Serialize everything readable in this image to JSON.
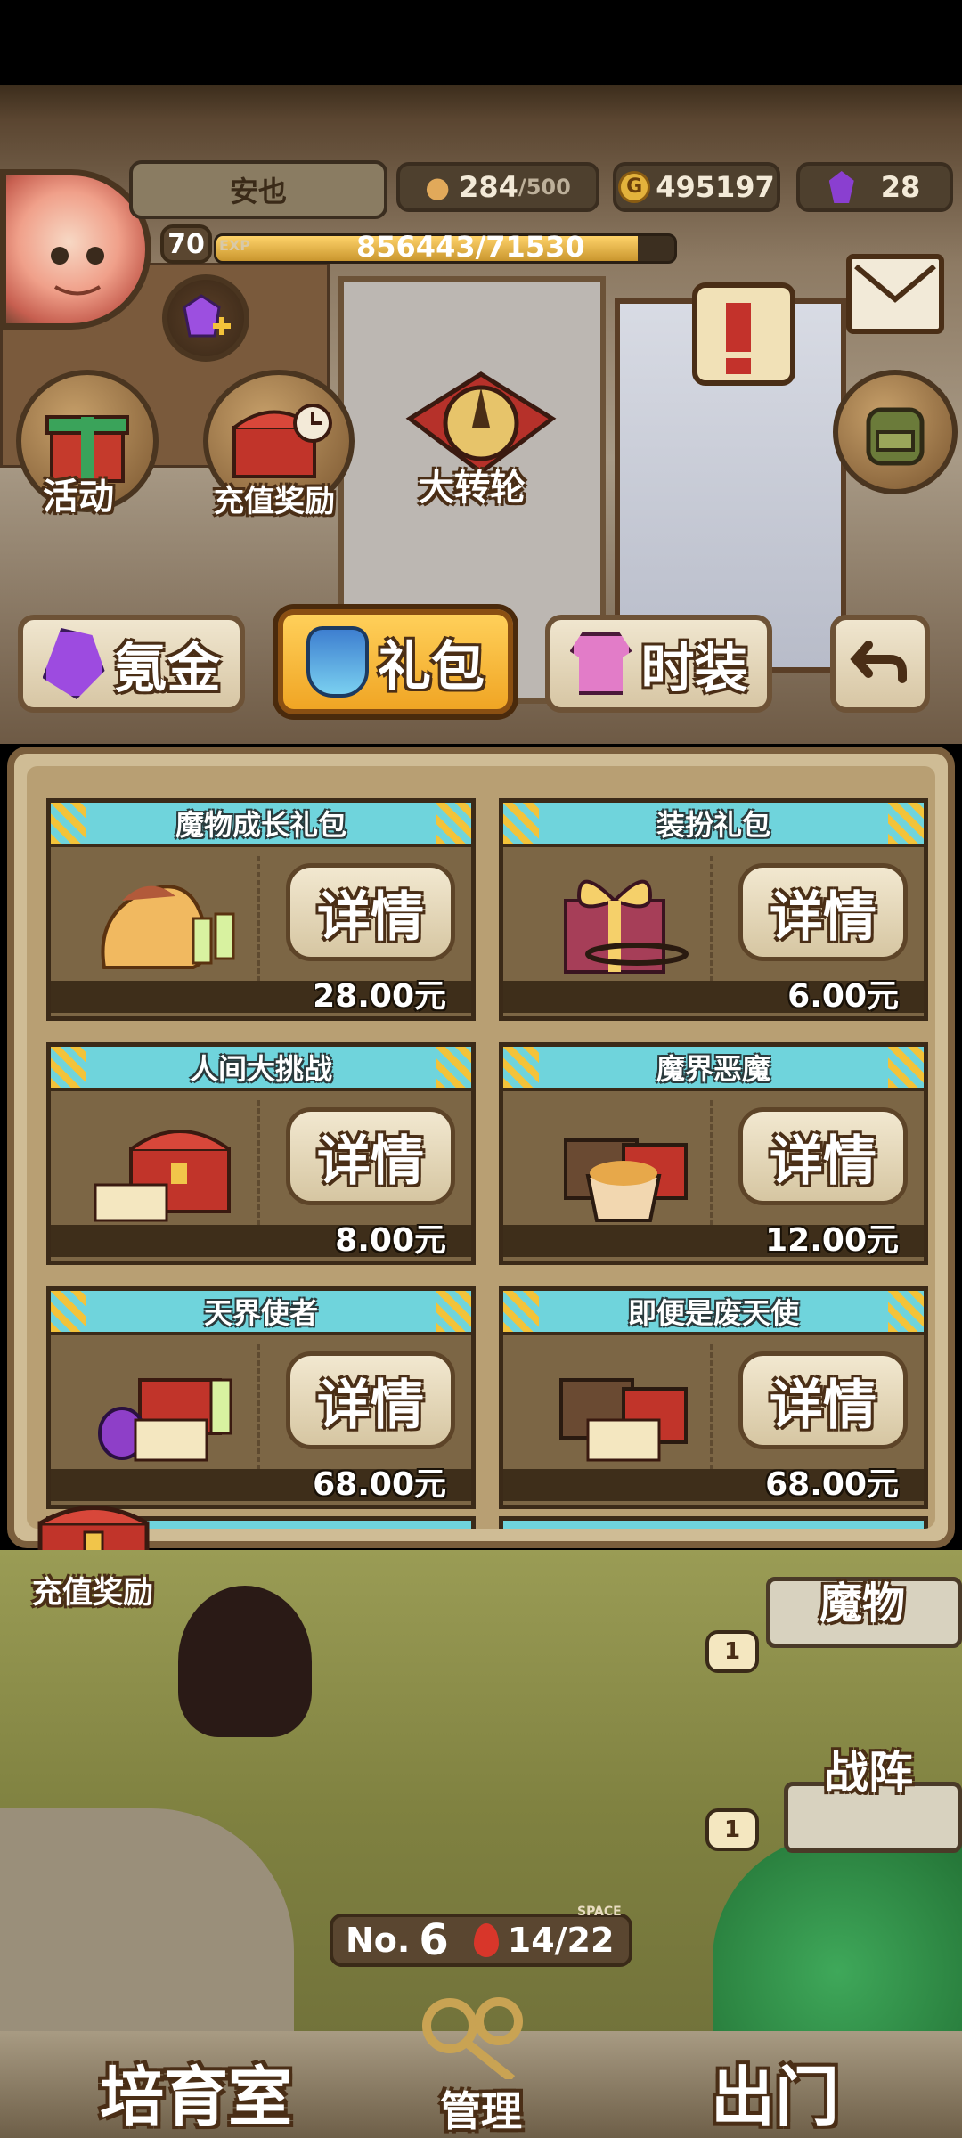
{
  "player": {
    "name": "安也",
    "level": "70",
    "exp_label": "EXP",
    "exp_value": "856443/71530",
    "exp_fraction": 0.92
  },
  "resources": {
    "stamina_current": "284",
    "stamina_max": "/500",
    "gold": "495197",
    "gems": "28"
  },
  "room_buttons": {
    "activity": "活动",
    "recharge_reward": "充值奖励",
    "wheel": "大转轮"
  },
  "tabs": [
    {
      "label": "氪金",
      "active": false
    },
    {
      "label": "礼包",
      "active": true
    },
    {
      "label": "时装",
      "active": false
    }
  ],
  "packs": [
    {
      "title": "魔物成长礼包",
      "button": "详情",
      "price": "28.00元"
    },
    {
      "title": "装扮礼包",
      "button": "详情",
      "price": "6.00元"
    },
    {
      "title": "人间大挑战",
      "button": "详情",
      "price": "8.00元"
    },
    {
      "title": "魔界恶魔",
      "button": "详情",
      "price": "12.00元"
    },
    {
      "title": "天界使者",
      "button": "详情",
      "price": "68.00元"
    },
    {
      "title": "即便是废天使",
      "button": "详情",
      "price": "68.00元"
    }
  ],
  "floating": {
    "recharge_reward": "充值奖励"
  },
  "scene": {
    "monster_label": "魔物",
    "formation_label": "战阵",
    "room_no_label": "No.",
    "room_no": "6",
    "capacity": "14/22",
    "space_label": "SPACE",
    "slot_level_1": "1",
    "slot_level_2": "1"
  },
  "bottom_nav": {
    "left": "培育室",
    "center": "管理",
    "right": "出门"
  },
  "colors": {
    "card_header": "#6fd4dc",
    "tab_active": "#f0a524",
    "exp_bar": "#ffd36a"
  }
}
